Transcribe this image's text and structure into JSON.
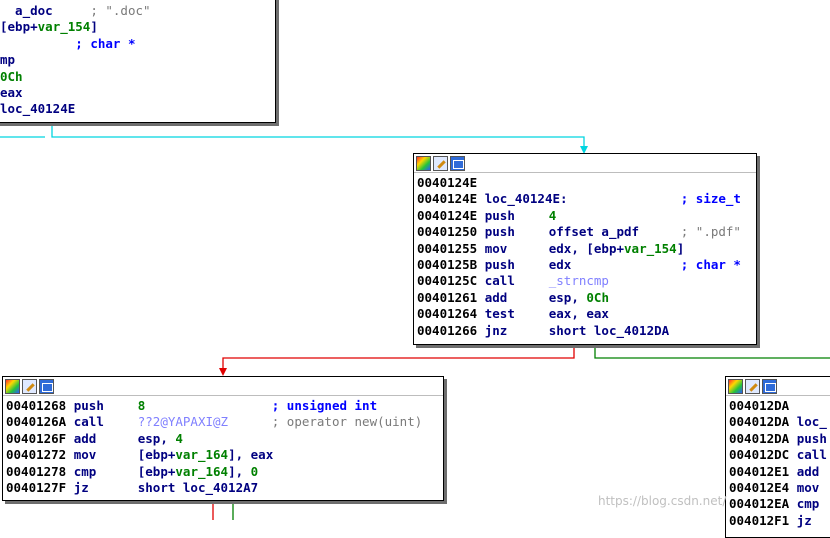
{
  "colors": {
    "edge_cyan": "#00d5e0",
    "edge_red": "#e00000",
    "edge_green": "#008000"
  },
  "watermark": "https://blog.csdn.net/",
  "node_top_left": {
    "rows": [
      {
        "c1": "  a_doc",
        "c2": "     ",
        "cmt": "; \".doc\""
      },
      {
        "c1": "[ebp+var_154]",
        "c2": ""
      },
      {
        "c1": "",
        "c2": "          ",
        "cmt": "; char *"
      },
      {
        "c1": "mp",
        "c2": ""
      },
      {
        "c1": "0Ch",
        "c2": ""
      },
      {
        "c1": "eax",
        "c2": ""
      },
      {
        "c1": "loc_40124E",
        "c2": ""
      }
    ]
  },
  "node_center": {
    "rows": [
      {
        "addr": "0040124E",
        "mn": "",
        "op": "",
        "cmt": ""
      },
      {
        "addr": "0040124E",
        "mn": "loc_40124E:",
        "op": "",
        "cmt": "; size_t"
      },
      {
        "addr": "0040124E",
        "mn": "push",
        "op": "4",
        "cmt": ""
      },
      {
        "addr": "00401250",
        "mn": "push",
        "op": "offset a_pdf",
        "cmt": "; \".pdf\""
      },
      {
        "addr": "00401255",
        "mn": "mov",
        "op": "edx, [ebp+var_154]",
        "cmt": ""
      },
      {
        "addr": "0040125B",
        "mn": "push",
        "op": "edx",
        "cmt": "; char *"
      },
      {
        "addr": "0040125C",
        "mn": "call",
        "op": "_strncmp",
        "cmt": ""
      },
      {
        "addr": "00401261",
        "mn": "add",
        "op": "esp, 0Ch",
        "cmt": ""
      },
      {
        "addr": "00401264",
        "mn": "test",
        "op": "eax, eax",
        "cmt": ""
      },
      {
        "addr": "00401266",
        "mn": "jnz",
        "op": "short loc_4012DA",
        "cmt": ""
      }
    ]
  },
  "node_bottom_left": {
    "rows": [
      {
        "addr": "00401268",
        "mn": "push",
        "op": "8",
        "cmt": "; unsigned int"
      },
      {
        "addr": "0040126A",
        "mn": "call",
        "op": "??2@YAPAXI@Z",
        "cmt": "; operator new(uint)"
      },
      {
        "addr": "0040126F",
        "mn": "add",
        "op": "esp, 4",
        "cmt": ""
      },
      {
        "addr": "00401272",
        "mn": "mov",
        "op": "[ebp+var_164], eax",
        "cmt": ""
      },
      {
        "addr": "00401278",
        "mn": "cmp",
        "op": "[ebp+var_164], 0",
        "cmt": ""
      },
      {
        "addr": "0040127F",
        "mn": "jz",
        "op": "short loc_4012A7",
        "cmt": ""
      }
    ]
  },
  "node_bottom_right": {
    "rows": [
      {
        "addr": "004012DA",
        "mn": ""
      },
      {
        "addr": "004012DA",
        "mn": "loc_"
      },
      {
        "addr": "004012DA",
        "mn": "push"
      },
      {
        "addr": "004012DC",
        "mn": "call"
      },
      {
        "addr": "004012E1",
        "mn": "add"
      },
      {
        "addr": "004012E4",
        "mn": "mov"
      },
      {
        "addr": "004012EA",
        "mn": "cmp"
      },
      {
        "addr": "004012F1",
        "mn": "jz"
      }
    ]
  }
}
